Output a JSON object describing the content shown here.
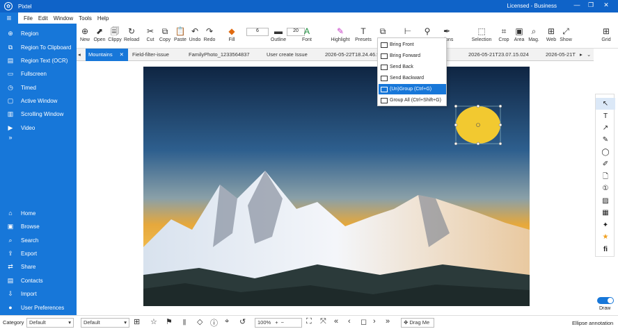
{
  "app": {
    "title": "Pixtel",
    "license": "Licensed - Business"
  },
  "window_controls": [
    "—",
    "❐",
    "✕"
  ],
  "menu": [
    "File",
    "Edit",
    "Window",
    "Tools",
    "Help"
  ],
  "sidebar": {
    "top": [
      {
        "label": "Region",
        "icon": "region-icon"
      },
      {
        "label": "Region To Clipboard",
        "icon": "clipboard-icon"
      },
      {
        "label": "Region Text (OCR)",
        "icon": "ocr-icon"
      },
      {
        "label": "Fullscreen",
        "icon": "monitor-icon"
      },
      {
        "label": "Timed",
        "icon": "timer-icon"
      },
      {
        "label": "Active Window",
        "icon": "window-icon"
      },
      {
        "label": "Scrolling Window",
        "icon": "scroll-window-icon"
      },
      {
        "label": "Video",
        "icon": "video-icon"
      }
    ],
    "expand": "»",
    "bottom": [
      {
        "label": "Home",
        "icon": "home-icon"
      },
      {
        "label": "Browse",
        "icon": "browse-icon"
      },
      {
        "label": "Search",
        "icon": "search-icon"
      },
      {
        "label": "Export",
        "icon": "export-icon"
      },
      {
        "label": "Share",
        "icon": "share-icon"
      },
      {
        "label": "Contacts",
        "icon": "contacts-icon"
      },
      {
        "label": "Import",
        "icon": "import-icon"
      },
      {
        "label": "User Preferences",
        "icon": "user-icon"
      }
    ]
  },
  "toolbar": [
    {
      "label": "New",
      "icon": "new-icon",
      "glyph": "⊕"
    },
    {
      "label": "Open",
      "icon": "open-icon",
      "glyph": "⬈"
    },
    {
      "label": "Clippy",
      "icon": "clippy-icon",
      "glyph": "🗐"
    },
    {
      "label": "Reload",
      "icon": "reload-icon",
      "glyph": "↻"
    },
    {
      "label": "Cut",
      "icon": "cut-icon",
      "glyph": "✂"
    },
    {
      "label": "Copy",
      "icon": "copy-icon",
      "glyph": "⧉"
    },
    {
      "label": "Paste",
      "icon": "paste-icon",
      "glyph": "📋"
    },
    {
      "label": "Undo",
      "icon": "undo-icon",
      "glyph": "↶"
    },
    {
      "label": "Redo",
      "icon": "redo-icon",
      "glyph": "↷"
    },
    {
      "label": "Fill",
      "icon": "fill-icon",
      "glyph": "◆"
    },
    {
      "label": "Outline",
      "icon": "outline-icon",
      "glyph": "▬"
    },
    {
      "label": "Font",
      "icon": "font-icon",
      "glyph": "A"
    },
    {
      "label": "Highlight",
      "icon": "highlight-icon",
      "glyph": "✎"
    },
    {
      "label": "Presets",
      "icon": "presets-icon",
      "glyph": "T"
    },
    {
      "label": "ations",
      "icon": "annotations-icon",
      "glyph": "✒"
    },
    {
      "label": "Selection",
      "icon": "selection-icon",
      "glyph": "⬚"
    },
    {
      "label": "Crop",
      "icon": "crop-icon",
      "glyph": "⌗"
    },
    {
      "label": "Area",
      "icon": "area-icon",
      "glyph": "▣"
    },
    {
      "label": "Mag.",
      "icon": "magnify-icon",
      "glyph": "⌕"
    },
    {
      "label": "Web",
      "icon": "web-icon",
      "glyph": "⊞"
    },
    {
      "label": "Show",
      "icon": "show-icon",
      "glyph": "⤢"
    },
    {
      "label": "Grid",
      "icon": "grid-icon",
      "glyph": "⊞"
    }
  ],
  "toolbar_values": {
    "outline_width": "6",
    "font_size": "20"
  },
  "tabs": [
    {
      "label": "Mountains",
      "close": "✕",
      "active": true
    },
    {
      "label": "Field-filter-issue"
    },
    {
      "label": "FamilyPhoto_1233564837"
    },
    {
      "label": "User create Issue"
    },
    {
      "label": "2026-05-22T18.24.46.9"
    },
    {
      "label": "2026-05-21T23.07.15.024"
    },
    {
      "label": "2026-05-21T"
    }
  ],
  "dropdown": [
    {
      "label": "Bring Front"
    },
    {
      "label": "Bring Forward"
    },
    {
      "label": "Send Back"
    },
    {
      "label": "Send Backward"
    },
    {
      "label": "(Un)Group (Ctrl+G)",
      "highlighted": true
    },
    {
      "label": "Group All (Ctrl+Shift+G)"
    }
  ],
  "right_tools": [
    "select-arrow-icon",
    "text-icon",
    "arrow-icon",
    "pen-icon",
    "ellipse-icon",
    "marker-icon",
    "note-icon",
    "step-number-icon",
    "image-icon",
    "blur-icon",
    "magic-icon",
    "star-icon",
    "fx-icon"
  ],
  "right_glyphs": [
    "↖",
    "T",
    "↗",
    "✎",
    "◯",
    "✐",
    "🗋",
    "①",
    "▨",
    "▦",
    "✦",
    "★",
    "fi"
  ],
  "draw_toggle": {
    "label": "Draw",
    "on": true
  },
  "status": {
    "category_label": "Category",
    "category_value": "Default",
    "second_value": "Default",
    "zoom": "100%",
    "drag": "Drag Me",
    "message": "Ellipse annotation"
  },
  "colors": {
    "accent": "#1777d9",
    "titlebar": "#0f63c8",
    "ellipse": "#f2c930"
  }
}
